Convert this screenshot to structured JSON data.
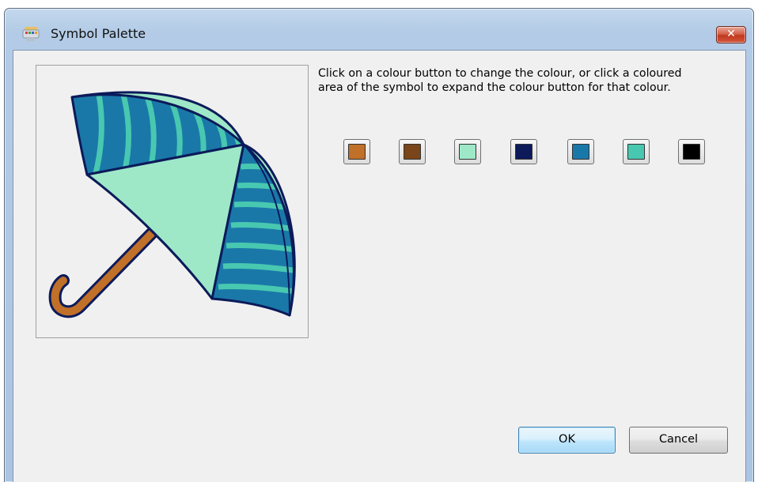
{
  "window": {
    "title": "Symbol Palette",
    "close_glyph": "✕",
    "title_icon": "palette-icon"
  },
  "preview": {
    "symbol": "umbrella",
    "symbol_icon": "umbrella-symbol"
  },
  "instructions": "Click on a colour button to change the colour, or click a coloured area of the symbol to expand the colour button for that colour.",
  "palette": {
    "swatches": [
      {
        "color": "#c07028"
      },
      {
        "color": "#7a4518"
      },
      {
        "color": "#9ee8c8"
      },
      {
        "color": "#0c1a5a"
      },
      {
        "color": "#1a78a8"
      },
      {
        "color": "#48c8b0"
      },
      {
        "color": "#000000"
      }
    ]
  },
  "buttons": {
    "ok_label": "OK",
    "cancel_label": "Cancel"
  }
}
